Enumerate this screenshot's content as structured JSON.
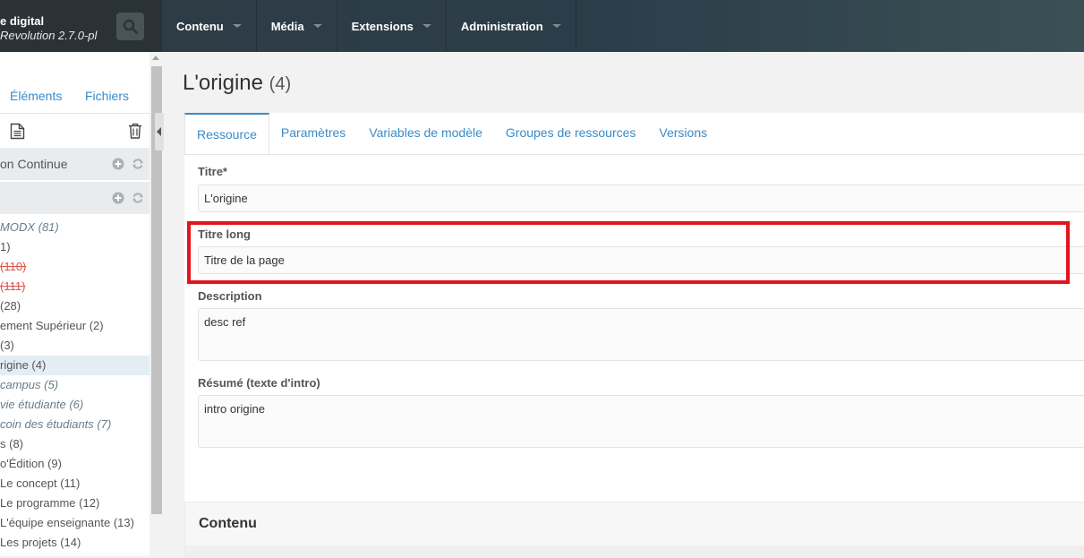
{
  "brand": {
    "site_name": "e digital",
    "version": "Revolution 2.7.0-pl"
  },
  "nav": {
    "items": [
      "Contenu",
      "Média",
      "Extensions",
      "Administration"
    ]
  },
  "sidebar": {
    "tabs": [
      "Éléments",
      "Fichiers"
    ],
    "contexts": [
      {
        "label": "on Continue"
      },
      {
        "label": ""
      }
    ],
    "tree": [
      {
        "label": "MODX (81)",
        "style": "italic"
      },
      {
        "label": "1)",
        "style": "normal"
      },
      {
        "label": "(110)",
        "style": "strike"
      },
      {
        "label": "(111)",
        "style": "strike"
      },
      {
        "label": "(28)",
        "style": "normal"
      },
      {
        "label": "ement Supérieur (2)",
        "style": "normal"
      },
      {
        "label": "(3)",
        "style": "normal"
      },
      {
        "label": "rigine (4)",
        "style": "active"
      },
      {
        "label": "campus (5)",
        "style": "italic"
      },
      {
        "label": "vie étudiante (6)",
        "style": "italic"
      },
      {
        "label": "coin des étudiants (7)",
        "style": "italic"
      },
      {
        "label": "s (8)",
        "style": "normal"
      },
      {
        "label": "o'Édition (9)",
        "style": "normal"
      },
      {
        "label": "Le concept (11)",
        "style": "normal"
      },
      {
        "label": "Le programme (12)",
        "style": "normal"
      },
      {
        "label": "L'équipe enseignante (13)",
        "style": "normal"
      },
      {
        "label": "Les projets (14)",
        "style": "normal"
      }
    ]
  },
  "page": {
    "title": "L'origine",
    "count": "(4)"
  },
  "tabs": [
    "Ressource",
    "Paramètres",
    "Variables de modèle",
    "Groupes de ressources",
    "Versions"
  ],
  "form": {
    "titre_label": "Titre*",
    "titre_value": "L'origine",
    "titre_long_label": "Titre long",
    "titre_long_value": "Titre de la page",
    "description_label": "Description",
    "description_value": "desc ref",
    "resume_label": "Résumé (texte d'intro)",
    "resume_value": "intro origine"
  },
  "content_section": {
    "title": "Contenu"
  },
  "colors": {
    "accent": "#3a8bc8",
    "highlight": "#e3141b",
    "topbar": "#2b3d49"
  }
}
